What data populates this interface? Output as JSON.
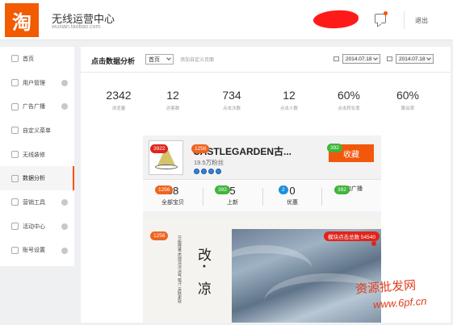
{
  "header": {
    "logo_char": "淘",
    "app_title": "无线运营中心",
    "app_subtitle": "wuxian.taobao.com",
    "logout_label": "退出"
  },
  "sidebar": {
    "items": [
      {
        "label": "首页",
        "icon": "home-icon"
      },
      {
        "label": "用户管理",
        "icon": "user-icon"
      },
      {
        "label": "广告广播",
        "icon": "speaker-icon"
      },
      {
        "label": "自定义菜单",
        "icon": "menu-icon"
      },
      {
        "label": "无线装修",
        "icon": "decorate-icon"
      },
      {
        "label": "数据分析",
        "icon": "chart-line-icon"
      },
      {
        "label": "营销工具",
        "icon": "tools-icon"
      },
      {
        "label": "活动中心",
        "icon": "activity-icon"
      },
      {
        "label": "账号设置",
        "icon": "settings-icon"
      }
    ]
  },
  "toolbar": {
    "title": "点击数据分析",
    "page_select": "首页",
    "add_page": "添加自定义页面",
    "date_from": "2014.07.18",
    "date_to": "2014.07.18"
  },
  "stats": [
    {
      "value": "2342",
      "label": "浏览量"
    },
    {
      "value": "12",
      "label": "访客数"
    },
    {
      "value": "734",
      "label": "点击次数"
    },
    {
      "value": "12",
      "label": "点击人数"
    },
    {
      "value": "60%",
      "label": "点击转化率"
    },
    {
      "value": "60%",
      "label": "跳出率"
    }
  ],
  "preview": {
    "shop_name": "CASTLEGARDEN古...",
    "shop_fans": "19.5万粉丝",
    "fav_label": "收藏",
    "logo_badge": "3922",
    "name_badge": "1256",
    "fav_badge": "392",
    "nav": [
      {
        "num": "58",
        "label": "全部宝贝",
        "badge": "1256"
      },
      {
        "num": "5",
        "label": "上新",
        "badge": "392"
      },
      {
        "num": "0",
        "label": "优惠",
        "badge": "2"
      },
      {
        "num": "",
        "label": "微淘广播",
        "badge": "392"
      }
    ],
    "banner_badge": "1256",
    "banner_char1": "改",
    "banner_char2": "凉",
    "banner_dot": "•",
    "ad_text": "节能降暑 质感清凉 透气吸汗 亲肤柔软",
    "module_clicks": "模块点击总数 54540"
  },
  "watermark": {
    "line1": "资源批发网",
    "line2": "www.6pf.cn"
  },
  "colors": {
    "brand": "#f25b00",
    "badge_red": "#e0251b",
    "badge_orange": "#f0641e",
    "badge_green": "#3fb53a",
    "badge_blue": "#1e8fe0"
  }
}
